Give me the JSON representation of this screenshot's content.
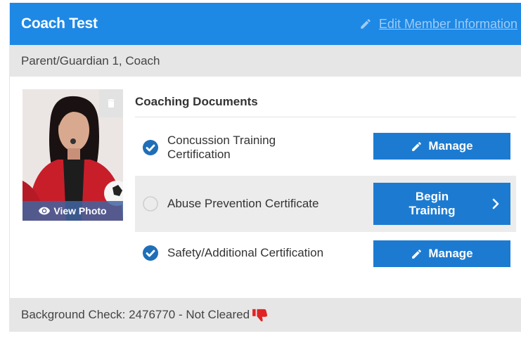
{
  "header": {
    "title": "Coach Test",
    "edit_label": "Edit Member Information"
  },
  "roles": "Parent/Guardian 1, Coach",
  "photo": {
    "view_label": "View Photo",
    "icons": [
      "trash-icon",
      "eye-icon"
    ]
  },
  "documents": {
    "title": "Coaching Documents",
    "items": [
      {
        "label_line1": "Concussion Training",
        "label_line2": "Certification",
        "status": "complete",
        "action": "Manage"
      },
      {
        "label": "Abuse Prevention Certificate",
        "status": "incomplete",
        "action_line1": "Begin",
        "action_line2": "Training"
      },
      {
        "label": "Safety/Additional Certification",
        "status": "complete",
        "action": "Manage"
      }
    ]
  },
  "footer": {
    "background_check": "Background Check: 2476770 - Not Cleared",
    "icon": "thumbs-down-icon"
  },
  "colors": {
    "header_blue": "#1e88e5",
    "button_blue": "#1c7bd1",
    "check_blue": "#1e6fb8",
    "thumb_red": "#e02424",
    "band_gray": "#e6e6e6"
  }
}
